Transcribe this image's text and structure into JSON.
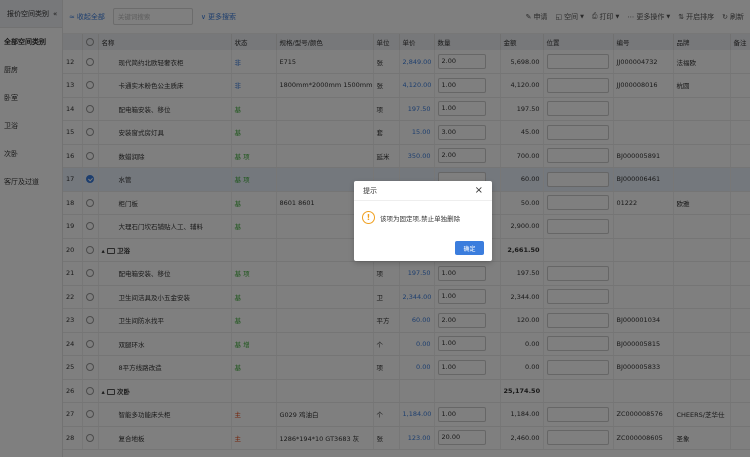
{
  "sidebar": {
    "header": "报价空间类别",
    "items": [
      {
        "label": "全部空间类别",
        "active": true
      },
      {
        "label": "厨房"
      },
      {
        "label": "卧室"
      },
      {
        "label": "卫浴"
      },
      {
        "label": "次卧"
      },
      {
        "label": "客厅及过道"
      }
    ]
  },
  "toolbar": {
    "collapse_all": "收起全部",
    "search_placeholder": "关键词搜索",
    "more_search": "更多搜索",
    "apply": "申请",
    "space": "空间",
    "print": "打印",
    "more_actions": "更多操作",
    "enable_sort": "开启排序",
    "refresh": "刷新"
  },
  "columns": [
    "",
    "名称",
    "状态",
    "规格/型号/颜色",
    "单位",
    "单价",
    "数量",
    "金额",
    "位置",
    "编号",
    "品牌",
    "备注"
  ],
  "rows": [
    {
      "no": "12",
      "name": "现代简约北欧轻奢衣柜",
      "status": "非",
      "sc": "blue",
      "spec": "E715",
      "unit": "张",
      "price": "2,849.00",
      "qty": "2.00",
      "amount": "5,698.00",
      "code": "JJ000004732",
      "brand": "法福欧"
    },
    {
      "no": "13",
      "name": "卡通实木粉色公主质床",
      "status": "非",
      "sc": "blue",
      "spec": "1800mm*2000mm 1500mm...",
      "unit": "张",
      "price": "4,120.00",
      "qty": "1.00",
      "amount": "4,120.00",
      "code": "JJ000008016",
      "brand": "杭圆"
    },
    {
      "no": "14",
      "name": "配电箱安装、移位",
      "status": "基",
      "sc": "green",
      "spec": "",
      "unit": "项",
      "price": "197.50",
      "qty": "1.00",
      "amount": "197.50",
      "code": "",
      "brand": ""
    },
    {
      "no": "15",
      "name": "安装窗式房灯具",
      "status": "基",
      "sc": "green",
      "spec": "",
      "unit": "套",
      "price": "15.00",
      "qty": "3.00",
      "amount": "45.00",
      "code": "",
      "brand": ""
    },
    {
      "no": "16",
      "name": "数蜡润除",
      "status": "基 项",
      "sc": "green",
      "spec": "",
      "unit": "延米",
      "price": "350.00",
      "qty": "2.00",
      "amount": "700.00",
      "code": "BJ000005891",
      "brand": ""
    },
    {
      "no": "17",
      "name": "水管",
      "status": "基 项",
      "sc": "green",
      "spec": "",
      "unit": "",
      "price": "",
      "qty": "",
      "amount": "60.00",
      "code": "BJ000006461",
      "brand": "",
      "selected": true
    },
    {
      "no": "18",
      "name": "柜门板",
      "status": "基",
      "sc": "green",
      "spec": "8601 8601",
      "unit": "",
      "price": "",
      "qty": "",
      "amount": "50.00",
      "code": "01222",
      "brand": "欧雅"
    },
    {
      "no": "19",
      "name": "大理石门坎石铺贴人工、辅料",
      "status": "基",
      "sc": "green",
      "spec": "",
      "unit": "",
      "price": "",
      "qty": "",
      "amount": "2,900.00",
      "code": "",
      "brand": ""
    },
    {
      "no": "20",
      "name": "卫浴",
      "group": true,
      "amount": "2,661.50"
    },
    {
      "no": "21",
      "name": "配电箱安装、移位",
      "status": "基 项",
      "sc": "green",
      "spec": "",
      "unit": "项",
      "price": "197.50",
      "qty": "1.00",
      "amount": "197.50",
      "code": "",
      "brand": ""
    },
    {
      "no": "22",
      "name": "卫生间洁具及小五金安装",
      "status": "基",
      "sc": "green",
      "spec": "",
      "unit": "卫",
      "price": "2,344.00",
      "qty": "1.00",
      "amount": "2,344.00",
      "code": "",
      "brand": ""
    },
    {
      "no": "23",
      "name": "卫生间防水找平",
      "status": "基",
      "sc": "green",
      "spec": "",
      "unit": "平方",
      "price": "60.00",
      "qty": "2.00",
      "amount": "120.00",
      "code": "BJ000001034",
      "brand": ""
    },
    {
      "no": "24",
      "name": "双腿环水",
      "status": "基 增",
      "sc": "green",
      "spec": "",
      "unit": "个",
      "price": "0.00",
      "qty": "1.00",
      "amount": "0.00",
      "code": "BJ000005815",
      "brand": ""
    },
    {
      "no": "25",
      "name": "8平方线路改造",
      "status": "基",
      "sc": "green",
      "spec": "",
      "unit": "项",
      "price": "0.00",
      "qty": "1.00",
      "amount": "0.00",
      "code": "BJ000005833",
      "brand": ""
    },
    {
      "no": "26",
      "name": "次卧",
      "group": true,
      "amount": "25,174.50"
    },
    {
      "no": "27",
      "name": "智能多功能床头柜",
      "status": "主",
      "sc": "red",
      "spec": "G029 鸡油白",
      "unit": "个",
      "price": "1,184.00",
      "qty": "1.00",
      "amount": "1,184.00",
      "code": "ZC000008576",
      "brand": "CHEERS/芝华仕"
    },
    {
      "no": "28",
      "name": "复合地板",
      "status": "主",
      "sc": "red",
      "spec": "1286*194*10 GT3683 灰",
      "unit": "张",
      "price": "123.00",
      "qty": "20.00",
      "amount": "2,460.00",
      "code": "ZC000008605",
      "brand": "圣象"
    }
  ],
  "dialog": {
    "title": "提示",
    "message": "该项为固定项,禁止单独删除",
    "confirm": "确定"
  }
}
